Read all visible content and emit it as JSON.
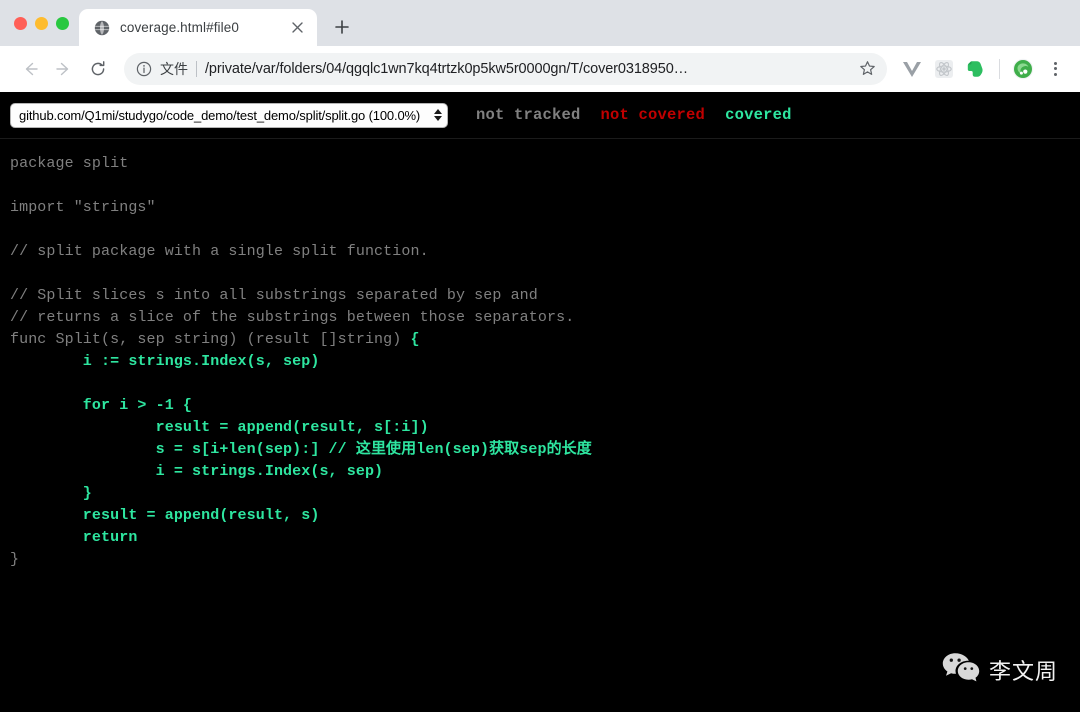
{
  "browser": {
    "traffic_lights": [
      {
        "name": "close",
        "color": "#ff5f57"
      },
      {
        "name": "minimize",
        "color": "#febc2e"
      },
      {
        "name": "maximize",
        "color": "#28c840"
      }
    ],
    "tab": {
      "title": "coverage.html#file0",
      "favicon": "globe-icon",
      "close_label": "✕"
    },
    "new_tab_label": "+",
    "nav": {
      "back": "←",
      "forward": "→",
      "reload": "reload-icon"
    },
    "omnibox": {
      "info_icon": "info-circle-icon",
      "scheme_label": "文件",
      "url": "/private/var/folders/04/qgqlc1wn7kq4trtzk0p5kw5r0000gn/T/cover0318950…",
      "star_icon": "star-outline-icon"
    },
    "extensions": [
      {
        "name": "vue-devtools-icon",
        "color": "#9aa0a6"
      },
      {
        "name": "react-devtools-icon",
        "color": "#c9ccd0"
      },
      {
        "name": "evernote-icon",
        "color": "#2dbe60"
      },
      {
        "name": "profile-avatar",
        "color": "#4caf50"
      }
    ],
    "menu_icon": "three-dot-menu-icon"
  },
  "coverage": {
    "file_select": {
      "selected": "github.com/Q1mi/studygo/code_demo/test_demo/split/split.go (100.0%)",
      "options": [
        "github.com/Q1mi/studygo/code_demo/test_demo/split/split.go (100.0%)"
      ]
    },
    "legend": {
      "not_tracked": "not tracked",
      "not_covered": "not covered",
      "covered": "covered"
    },
    "colors": {
      "background": "#000000",
      "not_tracked": "#808080",
      "not_covered": "#c00000",
      "covered": "#2ee6a0"
    },
    "source_lines": [
      [
        {
          "t": "package split",
          "c": "g0"
        }
      ],
      [
        {
          "t": "",
          "c": "g0"
        }
      ],
      [
        {
          "t": "import \"strings\"",
          "c": "g0"
        }
      ],
      [
        {
          "t": "",
          "c": "g0"
        }
      ],
      [
        {
          "t": "// split package with a single split function.",
          "c": "g0"
        }
      ],
      [
        {
          "t": "",
          "c": "g0"
        }
      ],
      [
        {
          "t": "// Split slices s into all substrings separated by sep and",
          "c": "g0"
        }
      ],
      [
        {
          "t": "// returns a slice of the substrings between those separators.",
          "c": "g0"
        }
      ],
      [
        {
          "t": "func Split(s, sep string) (result []string) ",
          "c": "g0"
        },
        {
          "t": "{",
          "c": "g1"
        }
      ],
      [
        {
          "t": "        i := strings.Index(s, sep)",
          "c": "g1"
        }
      ],
      [
        {
          "t": "",
          "c": "g0"
        }
      ],
      [
        {
          "t": "        for i > -1 {",
          "c": "g1"
        }
      ],
      [
        {
          "t": "                result = append(result, s[:i])",
          "c": "g1"
        }
      ],
      [
        {
          "t": "                s = s[i+len(sep):] // 这里使用len(sep)获取sep的长度",
          "c": "g1"
        }
      ],
      [
        {
          "t": "                i = strings.Index(s, sep)",
          "c": "g1"
        }
      ],
      [
        {
          "t": "        }",
          "c": "g1"
        }
      ],
      [
        {
          "t": "        result = append(result, s)",
          "c": "g1"
        }
      ],
      [
        {
          "t": "        return",
          "c": "g1"
        }
      ],
      [
        {
          "t": "}",
          "c": "g0"
        }
      ]
    ]
  },
  "watermark": {
    "icon": "wechat-icon",
    "text": "李文周"
  }
}
